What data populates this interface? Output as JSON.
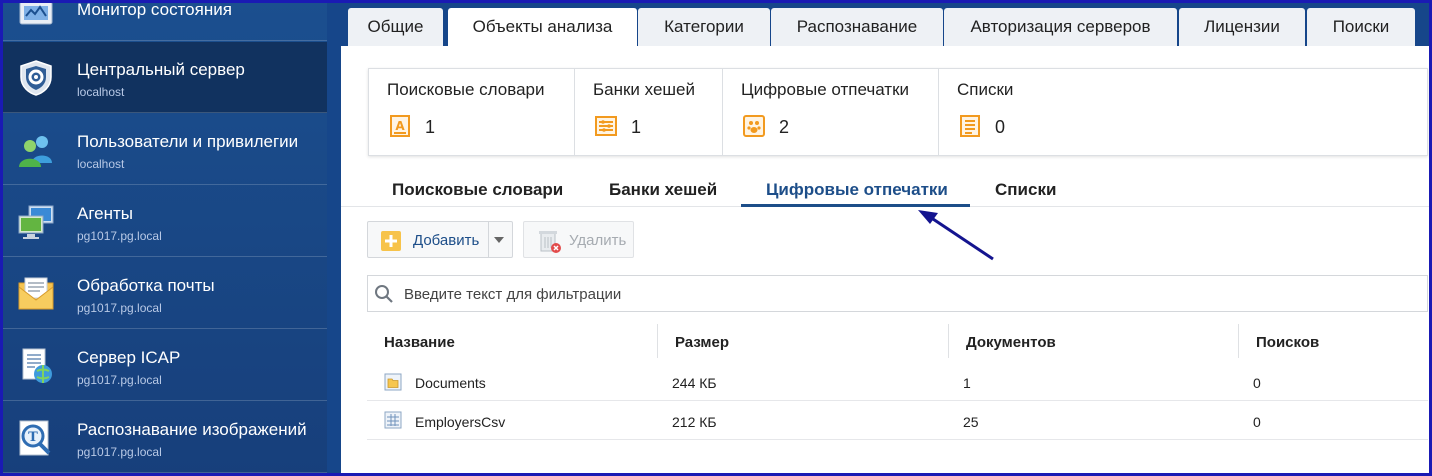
{
  "sidebar": {
    "items": [
      {
        "title": "Монитор состояния",
        "sub": "",
        "icon": "monitor-status-icon"
      },
      {
        "title": "Центральный сервер",
        "sub": "localhost",
        "icon": "shield-server-icon"
      },
      {
        "title": "Пользователи и привилегии",
        "sub": "localhost",
        "icon": "users-icon"
      },
      {
        "title": "Агенты",
        "sub": "pg1017.pg.local",
        "icon": "agents-computers-icon"
      },
      {
        "title": "Обработка почты",
        "sub": "pg1017.pg.local",
        "icon": "mail-envelope-icon"
      },
      {
        "title": "Сервер ICAP",
        "sub": "pg1017.pg.local",
        "icon": "icap-globe-icon"
      },
      {
        "title": "Распознавание изображений",
        "sub": "pg1017.pg.local",
        "icon": "image-recognition-icon"
      }
    ]
  },
  "tabs": [
    "Общие",
    "Объекты анализа",
    "Категории",
    "Распознавание",
    "Авторизация серверов",
    "Лицензии",
    "Поиски"
  ],
  "active_tab": "Объекты анализа",
  "summary": [
    {
      "label": "Поисковые словари",
      "count": "1",
      "icon": "dictionary-icon"
    },
    {
      "label": "Банки хешей",
      "count": "1",
      "icon": "hash-bank-icon"
    },
    {
      "label": "Цифровые отпечатки",
      "count": "2",
      "icon": "fingerprint-icon"
    },
    {
      "label": "Списки",
      "count": "0",
      "icon": "list-icon"
    }
  ],
  "subtabs": [
    "Поисковые словари",
    "Банки хешей",
    "Цифровые отпечатки",
    "Списки"
  ],
  "active_subtab": "Цифровые отпечатки",
  "toolbar": {
    "add_label": "Добавить",
    "delete_label": "Удалить"
  },
  "filter": {
    "placeholder": "Введите текст для фильтрации",
    "value": ""
  },
  "table": {
    "columns": [
      "Название",
      "Размер",
      "Документов",
      "Поисков"
    ],
    "rows": [
      {
        "name": "Documents",
        "size": "244 КБ",
        "docs": "1",
        "searches": "0",
        "icon": "folder-fingerprint-icon"
      },
      {
        "name": "EmployersCsv",
        "size": "212 КБ",
        "docs": "25",
        "searches": "0",
        "icon": "table-fingerprint-icon"
      }
    ]
  },
  "colors": {
    "sidebar": "#1b4f8f",
    "accent": "#1d4e89",
    "frame": "#1a1ab4",
    "orange": "#f29a1f"
  }
}
